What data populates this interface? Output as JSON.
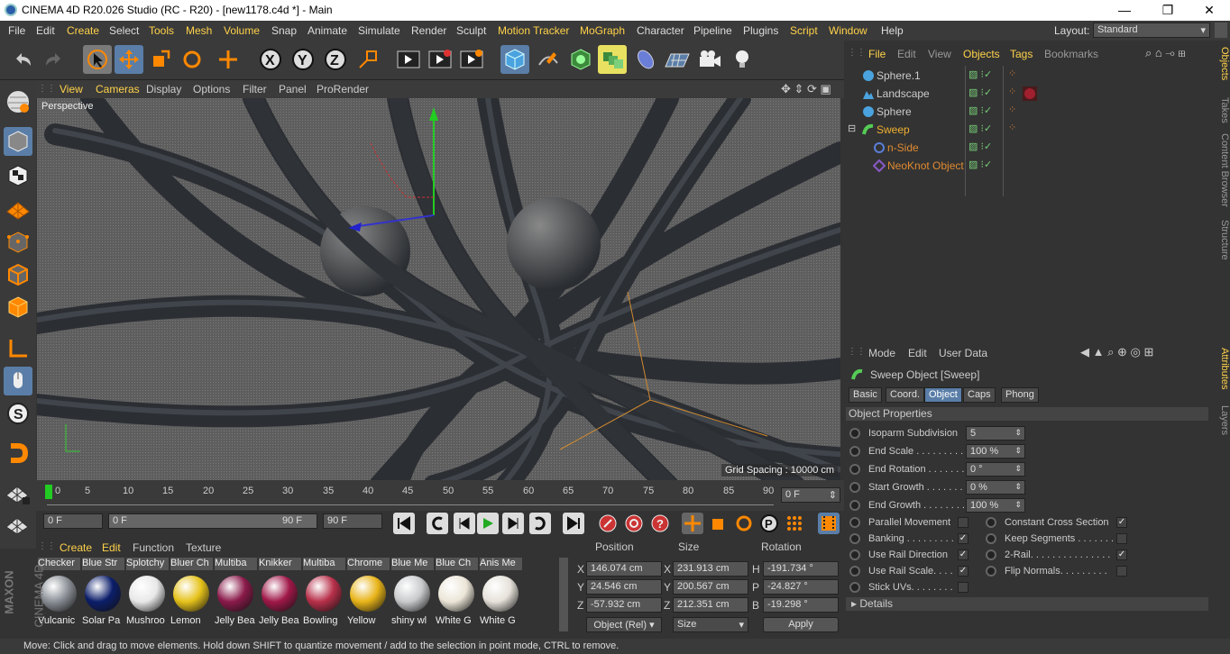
{
  "window": {
    "title": "CINEMA 4D R20.026 Studio (RC - R20) - [new1178.c4d *] - Main",
    "minimize": "—",
    "restore": "❐",
    "close": "✕"
  },
  "menu": [
    "File",
    "Edit",
    "Create",
    "Select",
    "Tools",
    "Mesh",
    "Volume",
    "Snap",
    "Animate",
    "Simulate",
    "Render",
    "Sculpt",
    "Motion Tracker",
    "MoGraph",
    "Character",
    "Pipeline",
    "Plugins",
    "Script",
    "Window",
    "Help"
  ],
  "layout": {
    "label": "Layout:",
    "value": "Standard"
  },
  "viewport": {
    "menu": [
      "View",
      "Cameras",
      "Display",
      "Options",
      "Filter",
      "Panel",
      "ProRender"
    ],
    "label": "Perspective",
    "grid_spacing": "Grid Spacing : 10000 cm"
  },
  "timeline": {
    "ticks": [
      "0",
      "5",
      "10",
      "15",
      "20",
      "25",
      "30",
      "35",
      "40",
      "45",
      "50",
      "55",
      "60",
      "65",
      "70",
      "75",
      "80",
      "85",
      "90"
    ],
    "current_frame": "0 F",
    "start": "0 F",
    "range_start": "0 F",
    "range_end": "90 F",
    "end": "90 F"
  },
  "materials": {
    "menu": [
      "Create",
      "Edit",
      "Function",
      "Texture"
    ],
    "items": [
      {
        "top": "Checker",
        "bottom": "Vulcanic",
        "color": "#8a8f96"
      },
      {
        "top": "Blue Str",
        "bottom": "Solar Pa",
        "color": "#0c1e6a"
      },
      {
        "top": "Splotchy",
        "bottom": "Mushroo",
        "color": "#e8e8e8"
      },
      {
        "top": "Bluer Ch",
        "bottom": "Lemon",
        "color": "#e6c21a"
      },
      {
        "top": "Multiba",
        "bottom": "Jelly Bea",
        "color": "#8a1a4a"
      },
      {
        "top": "Knikker",
        "bottom": "Jelly Bea",
        "color": "#a01848"
      },
      {
        "top": "Multiba",
        "bottom": "Bowling",
        "color": "#b8304a"
      },
      {
        "top": "Chrome",
        "bottom": "Yellow",
        "color": "#e8b418"
      },
      {
        "top": "Blue Me",
        "bottom": "shiny wl",
        "color": "#c8cacc"
      },
      {
        "top": "Blue Ch",
        "bottom": "White G",
        "color": "#ece6d8"
      },
      {
        "top": "Anis Me",
        "bottom": "White G",
        "color": "#e6e2da"
      }
    ]
  },
  "coordinates": {
    "headers": [
      "Position",
      "Size",
      "Rotation"
    ],
    "rows": [
      {
        "axis": "X",
        "pos": "146.074 cm",
        "size_axis": "X",
        "size": "231.913 cm",
        "rot_axis": "H",
        "rot": "-191.734 °"
      },
      {
        "axis": "Y",
        "pos": "24.546 cm",
        "size_axis": "Y",
        "size": "200.567 cm",
        "rot_axis": "P",
        "rot": "-24.827 °"
      },
      {
        "axis": "Z",
        "pos": "-57.932 cm",
        "size_axis": "Z",
        "size": "212.351 cm",
        "rot_axis": "B",
        "rot": "-19.298 °"
      }
    ],
    "mode": "Object (Rel)",
    "size_mode": "Size",
    "apply": "Apply"
  },
  "objects": {
    "menu": [
      "File",
      "Edit",
      "View",
      "Objects",
      "Tags",
      "Bookmarks"
    ],
    "items": [
      {
        "name": "Sphere.1",
        "color": "#ccc"
      },
      {
        "name": "Landscape",
        "color": "#ccc"
      },
      {
        "name": "Sphere",
        "color": "#ccc"
      },
      {
        "name": "Sweep",
        "color": "#f0b030"
      },
      {
        "name": "n-Side",
        "color": "#e08a30"
      },
      {
        "name": "NeoKnot Object",
        "color": "#e08a30"
      }
    ]
  },
  "side_tabs": [
    "Objects",
    "Takes",
    "Content Browser",
    "Structure"
  ],
  "side_tabs2": [
    "Attributes",
    "Layers"
  ],
  "attributes": {
    "menu": [
      "Mode",
      "Edit",
      "User Data"
    ],
    "title": "Sweep Object [Sweep]",
    "tabs": [
      "Basic",
      "Coord.",
      "Object",
      "Caps",
      "Phong"
    ],
    "section": "Object Properties",
    "fields": [
      {
        "label": "Isoparm Subdivision",
        "value": "5"
      },
      {
        "label": "End Scale . . . . . . . . . .",
        "value": "100 %"
      },
      {
        "label": "End Rotation . . . . . . .",
        "value": "0 °"
      },
      {
        "label": "Start Growth . . . . . . .",
        "value": "0 %"
      },
      {
        "label": "End Growth . . . . . . . .",
        "value": "100 %"
      }
    ],
    "checks_left": [
      {
        "label": "Parallel Movement",
        "checked": ""
      },
      {
        "label": "Banking . . . . . . . . .",
        "checked": "✓"
      },
      {
        "label": "Use Rail Direction",
        "checked": "✓"
      },
      {
        "label": "Use Rail Scale. . . .",
        "checked": "✓"
      },
      {
        "label": "Stick UVs. . . . . . . .",
        "checked": ""
      }
    ],
    "checks_right": [
      {
        "label": "Constant Cross Section",
        "checked": "✓"
      },
      {
        "label": "Keep Segments . . . . . . .",
        "checked": ""
      },
      {
        "label": "2-Rail. . . . . . . . . . . . . . .",
        "checked": "✓"
      },
      {
        "label": "Flip Normals. . . . . . . . .",
        "checked": ""
      }
    ],
    "details": "Details"
  },
  "logo": {
    "brand": "MAXON",
    "product": "CINEMA 4D"
  },
  "status": "Move: Click and drag to move elements. Hold down SHIFT to quantize movement / add to the selection in point mode, CTRL to remove."
}
